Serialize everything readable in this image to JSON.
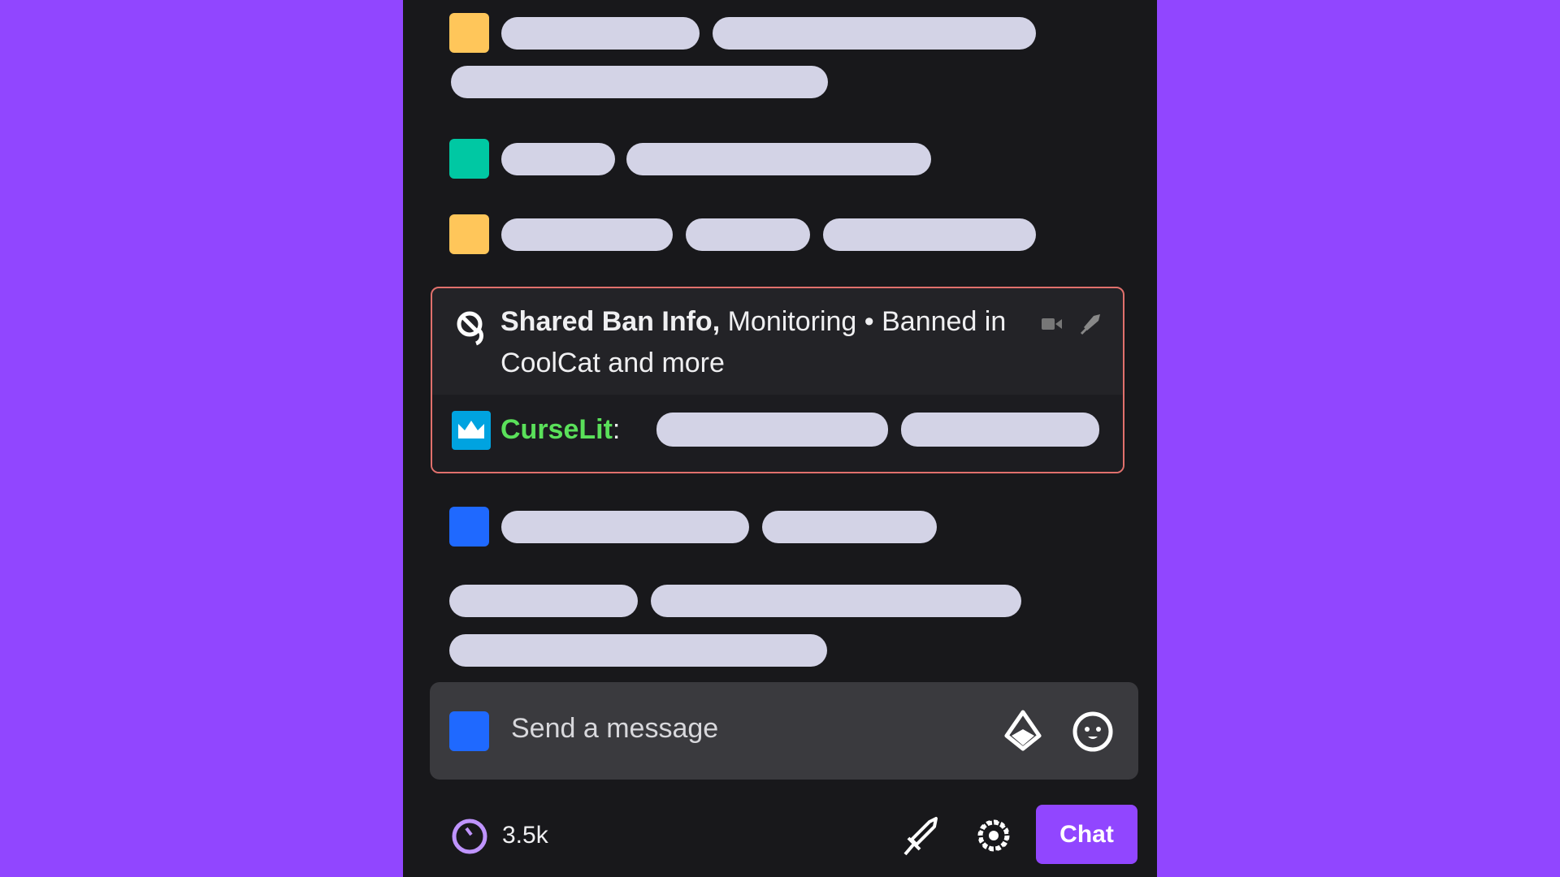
{
  "colors": {
    "background": "#9146ff",
    "panel": "#18181b",
    "yellow": "#ffc65a",
    "teal": "#00c8a3",
    "blue": "#1f69ff",
    "ban_border": "#e0706c",
    "username": "#5ae05a",
    "accent": "#9146ff"
  },
  "ban_card": {
    "icon": "shared-ban-icon",
    "title": "Shared Ban Info,",
    "status": "Monitoring • Banned in",
    "channels": "CoolCat and more",
    "username": "CurseLit",
    "separator": ":",
    "badge_icon": "crown-icon"
  },
  "input": {
    "placeholder": "Send a message",
    "bits_icon": "bits-diamond-icon",
    "emote_icon": "smiley-icon"
  },
  "footer": {
    "points": "3.5k",
    "points_icon": "channel-points-icon",
    "mod_icon": "sword-icon",
    "settings_icon": "gear-icon",
    "chat_label": "Chat"
  }
}
